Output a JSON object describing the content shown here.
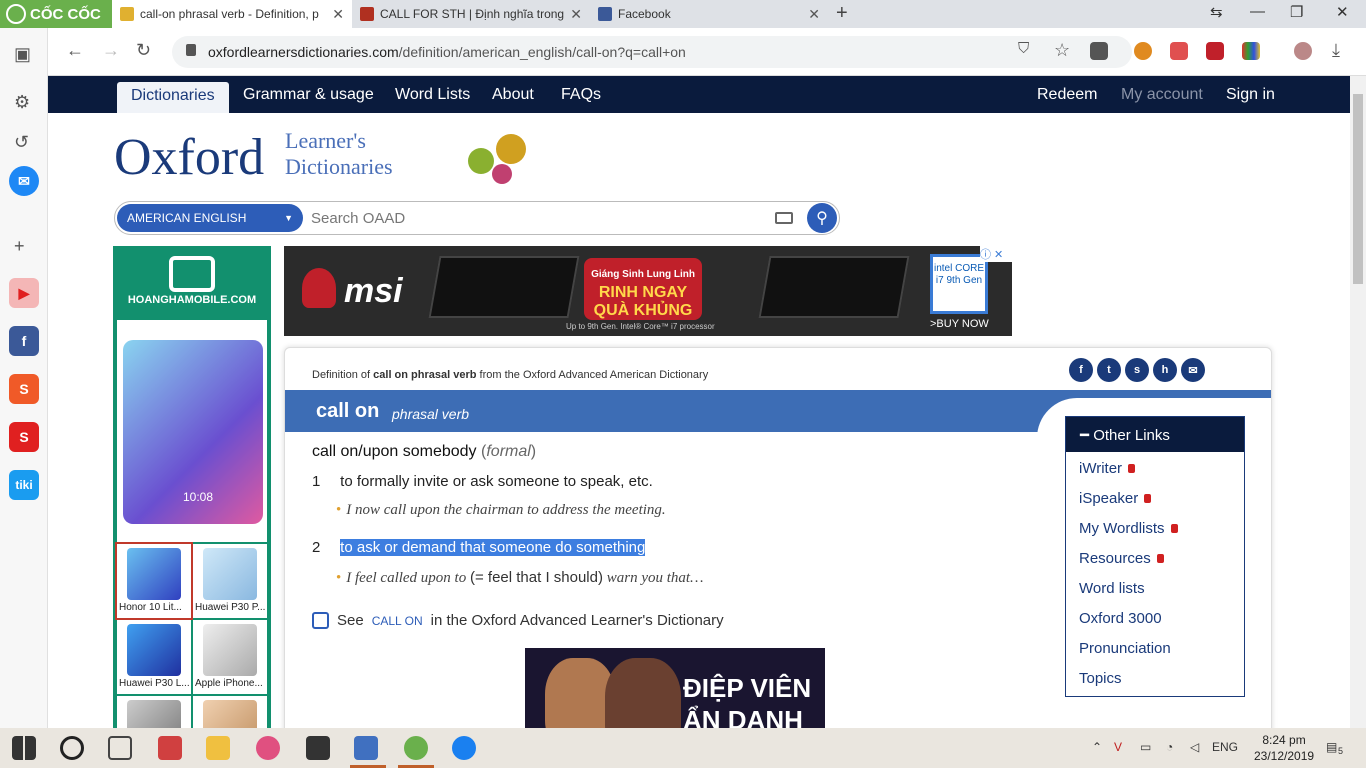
{
  "browser": {
    "brand": "CỐC CỐC",
    "tabs": [
      {
        "title": "call-on phrasal verb - Definition, p",
        "active": true
      },
      {
        "title": "CALL FOR STH | Định nghĩa trong T",
        "active": false
      },
      {
        "title": "Facebook",
        "active": false
      }
    ],
    "url_host": "oxfordlearnersdictionaries.com",
    "url_path": "/definition/american_english/call-on?q=call+on"
  },
  "site": {
    "nav": {
      "active": "Dictionaries",
      "items": [
        "Grammar & usage",
        "Word Lists",
        "About",
        "FAQs"
      ],
      "right": {
        "redeem": "Redeem",
        "account": "My account",
        "signin": "Sign in"
      }
    },
    "logo": {
      "main": "Oxford",
      "sub1": "Learner's",
      "sub2": "Dictionaries"
    },
    "search": {
      "dict": "AMERICAN ENGLISH",
      "placeholder": "Search OAAD"
    }
  },
  "ads": {
    "left": {
      "brand": "HOANGHAMOBILE.COM",
      "phone_time": "10:08",
      "products": [
        "Honor 10 Lit...",
        "Huawei P30 P...",
        "Huawei P30 L...",
        "Apple iPhone..."
      ]
    },
    "top": {
      "brand": "msi",
      "promo1": "Giáng Sinh Lung Linh",
      "promo2": "RINH NGAY",
      "promo3": "QUÀ KHỦNG",
      "fine": "Up to 9th Gen. Intel® Core™ i7 processor",
      "intel": "intel CORE i7 9th Gen",
      "buy": ">BUY NOW"
    },
    "bottom": {
      "title1": "ĐIỆP VIÊN",
      "title2": "ẨN DANH"
    }
  },
  "entry": {
    "def_prefix": "Definition of",
    "def_word": "call on phrasal verb",
    "def_suffix": "from the Oxford Advanced American Dictionary",
    "headword": "call on",
    "pos": "phrasal verb",
    "phrase": "call on/upon somebody",
    "phrase_label": "formal",
    "senses": [
      {
        "num": "1",
        "text": "to formally invite or ask someone to speak, etc.",
        "example": "I now call upon the chairman to address the meeting."
      },
      {
        "num": "2",
        "text": "to ask or demand that someone do something",
        "example_a": "I feel called upon to",
        "example_b": "(= feel that I should)",
        "example_c": "warn you that…"
      }
    ],
    "see_pre": "See",
    "see_word": "CALL ON",
    "see_post": "in the Oxford Advanced Learner's Dictionary"
  },
  "other_links": {
    "title": "Other Links",
    "items": [
      {
        "label": "iWriter",
        "locked": true
      },
      {
        "label": "iSpeaker",
        "locked": true
      },
      {
        "label": "My Wordlists",
        "locked": true
      },
      {
        "label": "Resources",
        "locked": true
      },
      {
        "label": "Word lists",
        "locked": false
      },
      {
        "label": "Oxford 3000",
        "locked": false
      },
      {
        "label": "Pronunciation",
        "locked": false
      },
      {
        "label": "Topics",
        "locked": false
      }
    ]
  },
  "taskbar": {
    "lang": "ENG",
    "time": "8:24 pm",
    "date": "23/12/2019",
    "notif": "5"
  },
  "colors": {
    "nav": "#0a1b3d",
    "accent": "#3d6db5",
    "selection": "#3d7ee0"
  }
}
